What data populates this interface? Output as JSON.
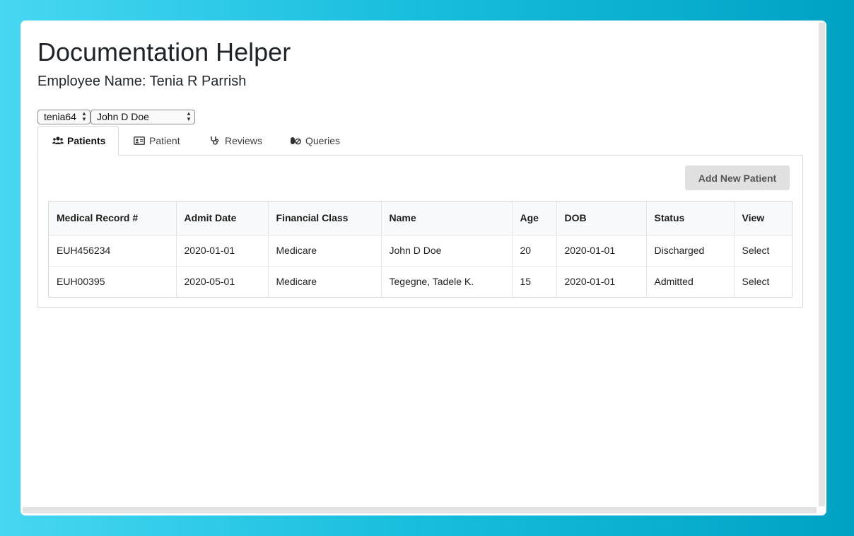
{
  "app": {
    "title": "Documentation Helper",
    "employee_label": "Employee Name: Tenia R Parrish"
  },
  "selectors": {
    "user": "tenia64",
    "patient": "John D Doe"
  },
  "tabs": [
    {
      "label": "Patients",
      "icon": "users-icon",
      "active": true
    },
    {
      "label": "Patient",
      "icon": "id-card-icon",
      "active": false
    },
    {
      "label": "Reviews",
      "icon": "stethoscope-icon",
      "active": false
    },
    {
      "label": "Queries",
      "icon": "pills-icon",
      "active": false
    }
  ],
  "panel": {
    "add_button": "Add New Patient"
  },
  "table": {
    "headers": [
      "Medical Record #",
      "Admit Date",
      "Financial Class",
      "Name",
      "Age",
      "DOB",
      "Status",
      "View"
    ],
    "rows": [
      [
        "EUH456234",
        "2020-01-01",
        "Medicare",
        "John D Doe",
        "20",
        "2020-01-01",
        "Discharged",
        "Select"
      ],
      [
        "EUH00395",
        "2020-05-01",
        "Medicare",
        "Tegegne, Tadele K.",
        "15",
        "2020-01-01",
        "Admitted",
        "Select"
      ]
    ]
  }
}
